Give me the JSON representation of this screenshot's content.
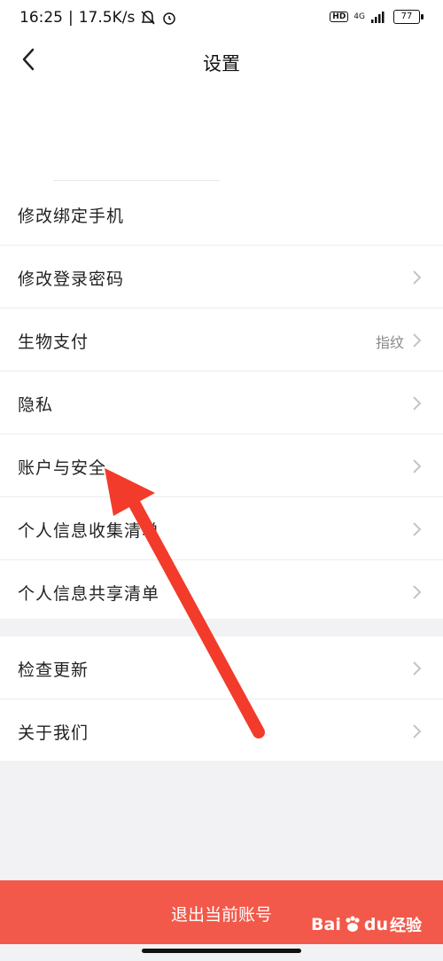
{
  "status": {
    "time": "16:25",
    "speed": "17.5K/s",
    "network": "4G",
    "battery": "77"
  },
  "header": {
    "title": "设置"
  },
  "group1": [
    {
      "label": "修改绑定手机",
      "value": "",
      "chevron": false
    },
    {
      "label": "修改登录密码",
      "value": "",
      "chevron": true
    },
    {
      "label": "生物支付",
      "value": "指纹",
      "chevron": true
    },
    {
      "label": "隐私",
      "value": "",
      "chevron": true
    },
    {
      "label": "账户与安全",
      "value": "",
      "chevron": true
    },
    {
      "label": "个人信息收集清单",
      "value": "",
      "chevron": true
    },
    {
      "label": "个人信息共享清单",
      "value": "",
      "chevron": true
    }
  ],
  "group2": [
    {
      "label": "检查更新",
      "chevron": true
    },
    {
      "label": "关于我们",
      "chevron": true
    }
  ],
  "logout_label": "退出当前账号",
  "watermark": {
    "text": "经验",
    "brand": "Bai du"
  },
  "colors": {
    "accent": "#f2594a",
    "arrow": "#f23b2a"
  }
}
